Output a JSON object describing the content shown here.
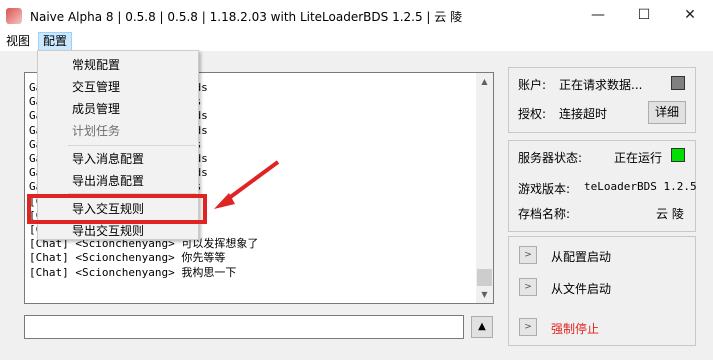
{
  "titlebar": {
    "title": "Naive Alpha 8 | 0.5.8 | 0.5.8 | 1.18.2.03 with LiteLoaderBDS 1.2.5 | 云 陵",
    "minimize": "—",
    "maximize": "☐",
    "close": "✕"
  },
  "menubar": {
    "view": "视图",
    "config": "配置"
  },
  "config_menu": {
    "items": [
      "常规配置",
      "交互管理",
      "成员管理",
      "计划任务",
      "导入消息配置",
      "导出消息配置",
      "导入交互规则",
      "导出交互规则"
    ],
    "disabled": [
      "计划任务"
    ],
    "highlighted": "导入交互规则"
  },
  "log": {
    "lines": [
      "Ga                          q7680269h for 70 seconds",
      "Ga                          q7680269h for 0 seconds",
      "Ga                          q7680269h for 70 seconds",
      "Ga                          q7680269h for 70 seconds",
      "Ga                          q7680269h for 0 seconds",
      "Ga                          q7680269h for 70 seconds",
      "Ga                          q7680269h for 70 seconds",
      "Ga                          q7680269h for 0 seconds",
      "[C                          想",
      "[C",
      "[C                          去进波货",
      "[Chat] <Scionchenyang> 可以发挥想象了",
      "[Chat] <Scionchenyang> 你先等等",
      "[Chat] <Scionchenyang> 我构思一下"
    ]
  },
  "account": {
    "label": "账户:",
    "value": "正在请求数据...",
    "status_color": "#808080",
    "auth_label": "授权:",
    "auth_value": "连接超时",
    "detail_button": "详细"
  },
  "server": {
    "status_label": "服务器状态:",
    "status_value": "正在运行",
    "status_color": "#00e000",
    "version_label": "游戏版本:",
    "version_value": "teLoaderBDS 1.2.5",
    "save_label": "存档名称:",
    "save_value": "云 陵"
  },
  "actions": {
    "start_config": "从配置启动",
    "start_file": "从文件启动",
    "force_stop": "强制停止"
  },
  "colors": {
    "accent": "#e02424",
    "menu_highlight": "#cce8ff"
  }
}
